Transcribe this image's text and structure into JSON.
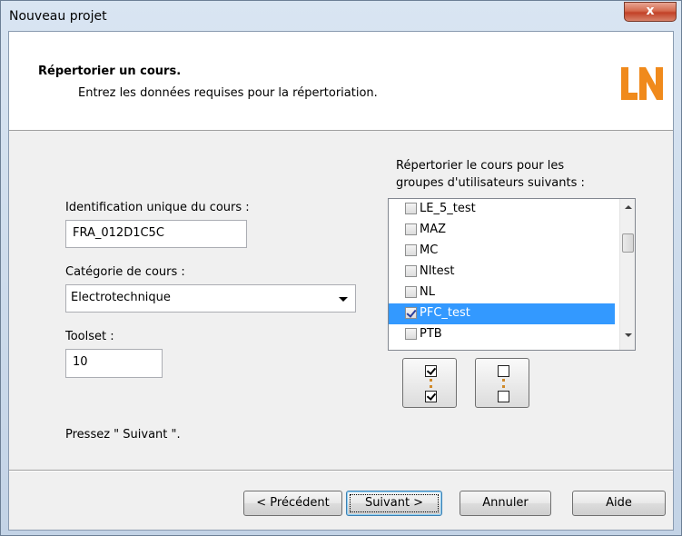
{
  "window": {
    "title": "Nouveau projet",
    "close_glyph": "x"
  },
  "header": {
    "title": "Répertorier un cours.",
    "subtitle": "Entrez les données requises pour la répertoriation.",
    "logo_icon": "ln-logo",
    "logo_color": "#f08a1c"
  },
  "form": {
    "course_id_label": "Identification unique du cours :",
    "course_id_value": "FRA_012D1C5C",
    "category_label": "Catégorie de cours :",
    "category_value": "Electrotechnique",
    "toolset_label": "Toolset :",
    "toolset_value": "10",
    "hint": "Pressez \" Suivant \"."
  },
  "groups": {
    "label_line1": "Répertorier le cours pour les",
    "label_line2": "groupes d'utilisateurs suivants :",
    "items": [
      {
        "label": "LE_5_test",
        "checked": false,
        "selected": false
      },
      {
        "label": "MAZ",
        "checked": false,
        "selected": false
      },
      {
        "label": "MC",
        "checked": false,
        "selected": false
      },
      {
        "label": "NItest",
        "checked": false,
        "selected": false
      },
      {
        "label": "NL",
        "checked": false,
        "selected": false
      },
      {
        "label": "PFC_test",
        "checked": true,
        "selected": true
      },
      {
        "label": "PTB",
        "checked": false,
        "selected": false
      }
    ],
    "select_all_icon": "check-all-icon",
    "deselect_all_icon": "uncheck-all-icon"
  },
  "buttons": {
    "previous": "< Précédent",
    "next": "Suivant >",
    "cancel": "Annuler",
    "help": "Aide"
  },
  "colors": {
    "selection": "#3399ff",
    "close": "#c24127"
  }
}
